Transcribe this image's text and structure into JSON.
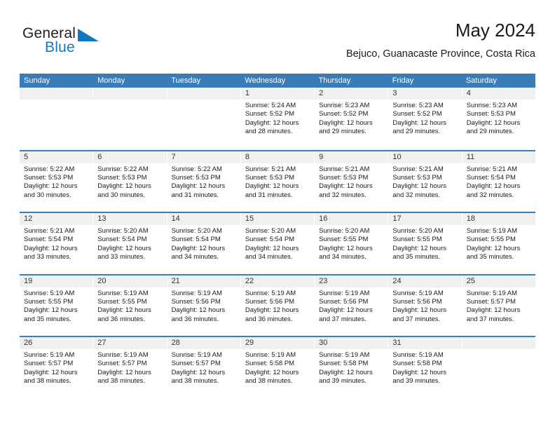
{
  "logo": {
    "word_one": "General",
    "word_two": "Blue",
    "triangle_icon": "triangle-icon"
  },
  "header": {
    "title": "May 2024",
    "subtitle": "Bejuco, Guanacaste Province, Costa Rica"
  },
  "colors": {
    "header_blue": "#3a7cb8",
    "logo_blue": "#1278be",
    "day_band_gray": "#f0f0f0",
    "text": "#1a1a1a"
  },
  "calendar": {
    "weekdays": [
      "Sunday",
      "Monday",
      "Tuesday",
      "Wednesday",
      "Thursday",
      "Friday",
      "Saturday"
    ],
    "weeks": [
      [
        {
          "day": "",
          "empty": true
        },
        {
          "day": "",
          "empty": true
        },
        {
          "day": "",
          "empty": true
        },
        {
          "day": "1",
          "sunrise": "Sunrise: 5:24 AM",
          "sunset": "Sunset: 5:52 PM",
          "daylight_line1": "Daylight: 12 hours",
          "daylight_line2": "and 28 minutes."
        },
        {
          "day": "2",
          "sunrise": "Sunrise: 5:23 AM",
          "sunset": "Sunset: 5:52 PM",
          "daylight_line1": "Daylight: 12 hours",
          "daylight_line2": "and 29 minutes."
        },
        {
          "day": "3",
          "sunrise": "Sunrise: 5:23 AM",
          "sunset": "Sunset: 5:52 PM",
          "daylight_line1": "Daylight: 12 hours",
          "daylight_line2": "and 29 minutes."
        },
        {
          "day": "4",
          "sunrise": "Sunrise: 5:23 AM",
          "sunset": "Sunset: 5:53 PM",
          "daylight_line1": "Daylight: 12 hours",
          "daylight_line2": "and 29 minutes."
        }
      ],
      [
        {
          "day": "5",
          "sunrise": "Sunrise: 5:22 AM",
          "sunset": "Sunset: 5:53 PM",
          "daylight_line1": "Daylight: 12 hours",
          "daylight_line2": "and 30 minutes."
        },
        {
          "day": "6",
          "sunrise": "Sunrise: 5:22 AM",
          "sunset": "Sunset: 5:53 PM",
          "daylight_line1": "Daylight: 12 hours",
          "daylight_line2": "and 30 minutes."
        },
        {
          "day": "7",
          "sunrise": "Sunrise: 5:22 AM",
          "sunset": "Sunset: 5:53 PM",
          "daylight_line1": "Daylight: 12 hours",
          "daylight_line2": "and 31 minutes."
        },
        {
          "day": "8",
          "sunrise": "Sunrise: 5:21 AM",
          "sunset": "Sunset: 5:53 PM",
          "daylight_line1": "Daylight: 12 hours",
          "daylight_line2": "and 31 minutes."
        },
        {
          "day": "9",
          "sunrise": "Sunrise: 5:21 AM",
          "sunset": "Sunset: 5:53 PM",
          "daylight_line1": "Daylight: 12 hours",
          "daylight_line2": "and 32 minutes."
        },
        {
          "day": "10",
          "sunrise": "Sunrise: 5:21 AM",
          "sunset": "Sunset: 5:53 PM",
          "daylight_line1": "Daylight: 12 hours",
          "daylight_line2": "and 32 minutes."
        },
        {
          "day": "11",
          "sunrise": "Sunrise: 5:21 AM",
          "sunset": "Sunset: 5:54 PM",
          "daylight_line1": "Daylight: 12 hours",
          "daylight_line2": "and 32 minutes."
        }
      ],
      [
        {
          "day": "12",
          "sunrise": "Sunrise: 5:21 AM",
          "sunset": "Sunset: 5:54 PM",
          "daylight_line1": "Daylight: 12 hours",
          "daylight_line2": "and 33 minutes."
        },
        {
          "day": "13",
          "sunrise": "Sunrise: 5:20 AM",
          "sunset": "Sunset: 5:54 PM",
          "daylight_line1": "Daylight: 12 hours",
          "daylight_line2": "and 33 minutes."
        },
        {
          "day": "14",
          "sunrise": "Sunrise: 5:20 AM",
          "sunset": "Sunset: 5:54 PM",
          "daylight_line1": "Daylight: 12 hours",
          "daylight_line2": "and 34 minutes."
        },
        {
          "day": "15",
          "sunrise": "Sunrise: 5:20 AM",
          "sunset": "Sunset: 5:54 PM",
          "daylight_line1": "Daylight: 12 hours",
          "daylight_line2": "and 34 minutes."
        },
        {
          "day": "16",
          "sunrise": "Sunrise: 5:20 AM",
          "sunset": "Sunset: 5:55 PM",
          "daylight_line1": "Daylight: 12 hours",
          "daylight_line2": "and 34 minutes."
        },
        {
          "day": "17",
          "sunrise": "Sunrise: 5:20 AM",
          "sunset": "Sunset: 5:55 PM",
          "daylight_line1": "Daylight: 12 hours",
          "daylight_line2": "and 35 minutes."
        },
        {
          "day": "18",
          "sunrise": "Sunrise: 5:19 AM",
          "sunset": "Sunset: 5:55 PM",
          "daylight_line1": "Daylight: 12 hours",
          "daylight_line2": "and 35 minutes."
        }
      ],
      [
        {
          "day": "19",
          "sunrise": "Sunrise: 5:19 AM",
          "sunset": "Sunset: 5:55 PM",
          "daylight_line1": "Daylight: 12 hours",
          "daylight_line2": "and 35 minutes."
        },
        {
          "day": "20",
          "sunrise": "Sunrise: 5:19 AM",
          "sunset": "Sunset: 5:55 PM",
          "daylight_line1": "Daylight: 12 hours",
          "daylight_line2": "and 36 minutes."
        },
        {
          "day": "21",
          "sunrise": "Sunrise: 5:19 AM",
          "sunset": "Sunset: 5:56 PM",
          "daylight_line1": "Daylight: 12 hours",
          "daylight_line2": "and 36 minutes."
        },
        {
          "day": "22",
          "sunrise": "Sunrise: 5:19 AM",
          "sunset": "Sunset: 5:56 PM",
          "daylight_line1": "Daylight: 12 hours",
          "daylight_line2": "and 36 minutes."
        },
        {
          "day": "23",
          "sunrise": "Sunrise: 5:19 AM",
          "sunset": "Sunset: 5:56 PM",
          "daylight_line1": "Daylight: 12 hours",
          "daylight_line2": "and 37 minutes."
        },
        {
          "day": "24",
          "sunrise": "Sunrise: 5:19 AM",
          "sunset": "Sunset: 5:56 PM",
          "daylight_line1": "Daylight: 12 hours",
          "daylight_line2": "and 37 minutes."
        },
        {
          "day": "25",
          "sunrise": "Sunrise: 5:19 AM",
          "sunset": "Sunset: 5:57 PM",
          "daylight_line1": "Daylight: 12 hours",
          "daylight_line2": "and 37 minutes."
        }
      ],
      [
        {
          "day": "26",
          "sunrise": "Sunrise: 5:19 AM",
          "sunset": "Sunset: 5:57 PM",
          "daylight_line1": "Daylight: 12 hours",
          "daylight_line2": "and 38 minutes."
        },
        {
          "day": "27",
          "sunrise": "Sunrise: 5:19 AM",
          "sunset": "Sunset: 5:57 PM",
          "daylight_line1": "Daylight: 12 hours",
          "daylight_line2": "and 38 minutes."
        },
        {
          "day": "28",
          "sunrise": "Sunrise: 5:19 AM",
          "sunset": "Sunset: 5:57 PM",
          "daylight_line1": "Daylight: 12 hours",
          "daylight_line2": "and 38 minutes."
        },
        {
          "day": "29",
          "sunrise": "Sunrise: 5:19 AM",
          "sunset": "Sunset: 5:58 PM",
          "daylight_line1": "Daylight: 12 hours",
          "daylight_line2": "and 38 minutes."
        },
        {
          "day": "30",
          "sunrise": "Sunrise: 5:19 AM",
          "sunset": "Sunset: 5:58 PM",
          "daylight_line1": "Daylight: 12 hours",
          "daylight_line2": "and 39 minutes."
        },
        {
          "day": "31",
          "sunrise": "Sunrise: 5:19 AM",
          "sunset": "Sunset: 5:58 PM",
          "daylight_line1": "Daylight: 12 hours",
          "daylight_line2": "and 39 minutes."
        },
        {
          "day": "",
          "empty": true
        }
      ]
    ]
  }
}
